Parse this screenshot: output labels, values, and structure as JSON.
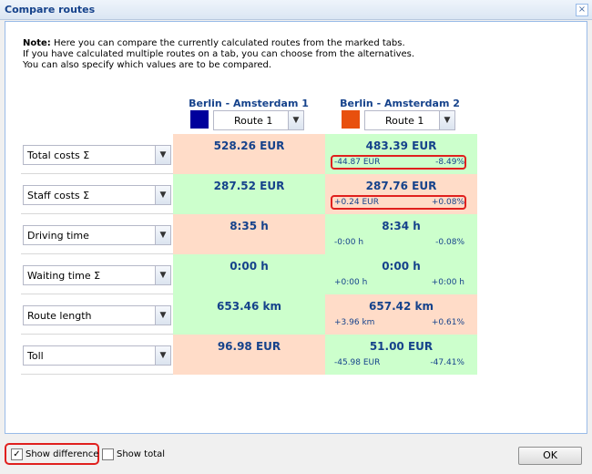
{
  "window": {
    "title": "Compare routes",
    "close_glyph": "×"
  },
  "note": {
    "label": "Note:",
    "line1": " Here you can compare the currently calculated routes from the marked tabs.",
    "line2": "If you have calculated multiple routes on a tab, you can choose from the alternatives.",
    "line3": "You can also specify which values are to be compared."
  },
  "routes": [
    {
      "name": "Berlin - Amsterdam 1",
      "color": "#00009c",
      "selected": "Route 1"
    },
    {
      "name": "Berlin - Amsterdam 2",
      "color": "#e8500e",
      "selected": "Route 1"
    }
  ],
  "rows": [
    {
      "metric": "Total costs Σ",
      "v1": "528.26 EUR",
      "v2": "483.39 EUR",
      "d_abs": "-44.87 EUR",
      "d_pct": "-8.49%",
      "c1": "pink",
      "c2": "green",
      "highlight": true
    },
    {
      "metric": "Staff costs Σ",
      "v1": "287.52 EUR",
      "v2": "287.76 EUR",
      "d_abs": "+0.24 EUR",
      "d_pct": "+0.08%",
      "c1": "green",
      "c2": "pink",
      "highlight": true
    },
    {
      "metric": "Driving time",
      "v1": "8:35 h",
      "v2": "8:34 h",
      "d_abs": "-0:00 h",
      "d_pct": "-0.08%",
      "c1": "pink",
      "c2": "green",
      "highlight": false
    },
    {
      "metric": "Waiting time Σ",
      "v1": "0:00 h",
      "v2": "0:00 h",
      "d_abs": "+0:00 h",
      "d_pct": "+0:00 h",
      "c1": "green",
      "c2": "green",
      "highlight": false
    },
    {
      "metric": "Route length",
      "v1": "653.46 km",
      "v2": "657.42 km",
      "d_abs": "+3.96 km",
      "d_pct": "+0.61%",
      "c1": "green",
      "c2": "pink",
      "highlight": false
    },
    {
      "metric": "Toll",
      "v1": "96.98 EUR",
      "v2": "51.00 EUR",
      "d_abs": "-45.98 EUR",
      "d_pct": "-47.41%",
      "c1": "pink",
      "c2": "green",
      "highlight": false
    }
  ],
  "footer": {
    "show_difference": "Show difference",
    "show_difference_checked": true,
    "show_total": "Show total",
    "show_total_checked": false,
    "ok": "OK"
  },
  "colors": {
    "green": "#ccffcc",
    "pink": "#ffdcc8",
    "accent": "#15428b",
    "highlight": "#e0201e"
  },
  "icons": {
    "dropdown": "chevron-down-icon",
    "check": "check-icon"
  }
}
